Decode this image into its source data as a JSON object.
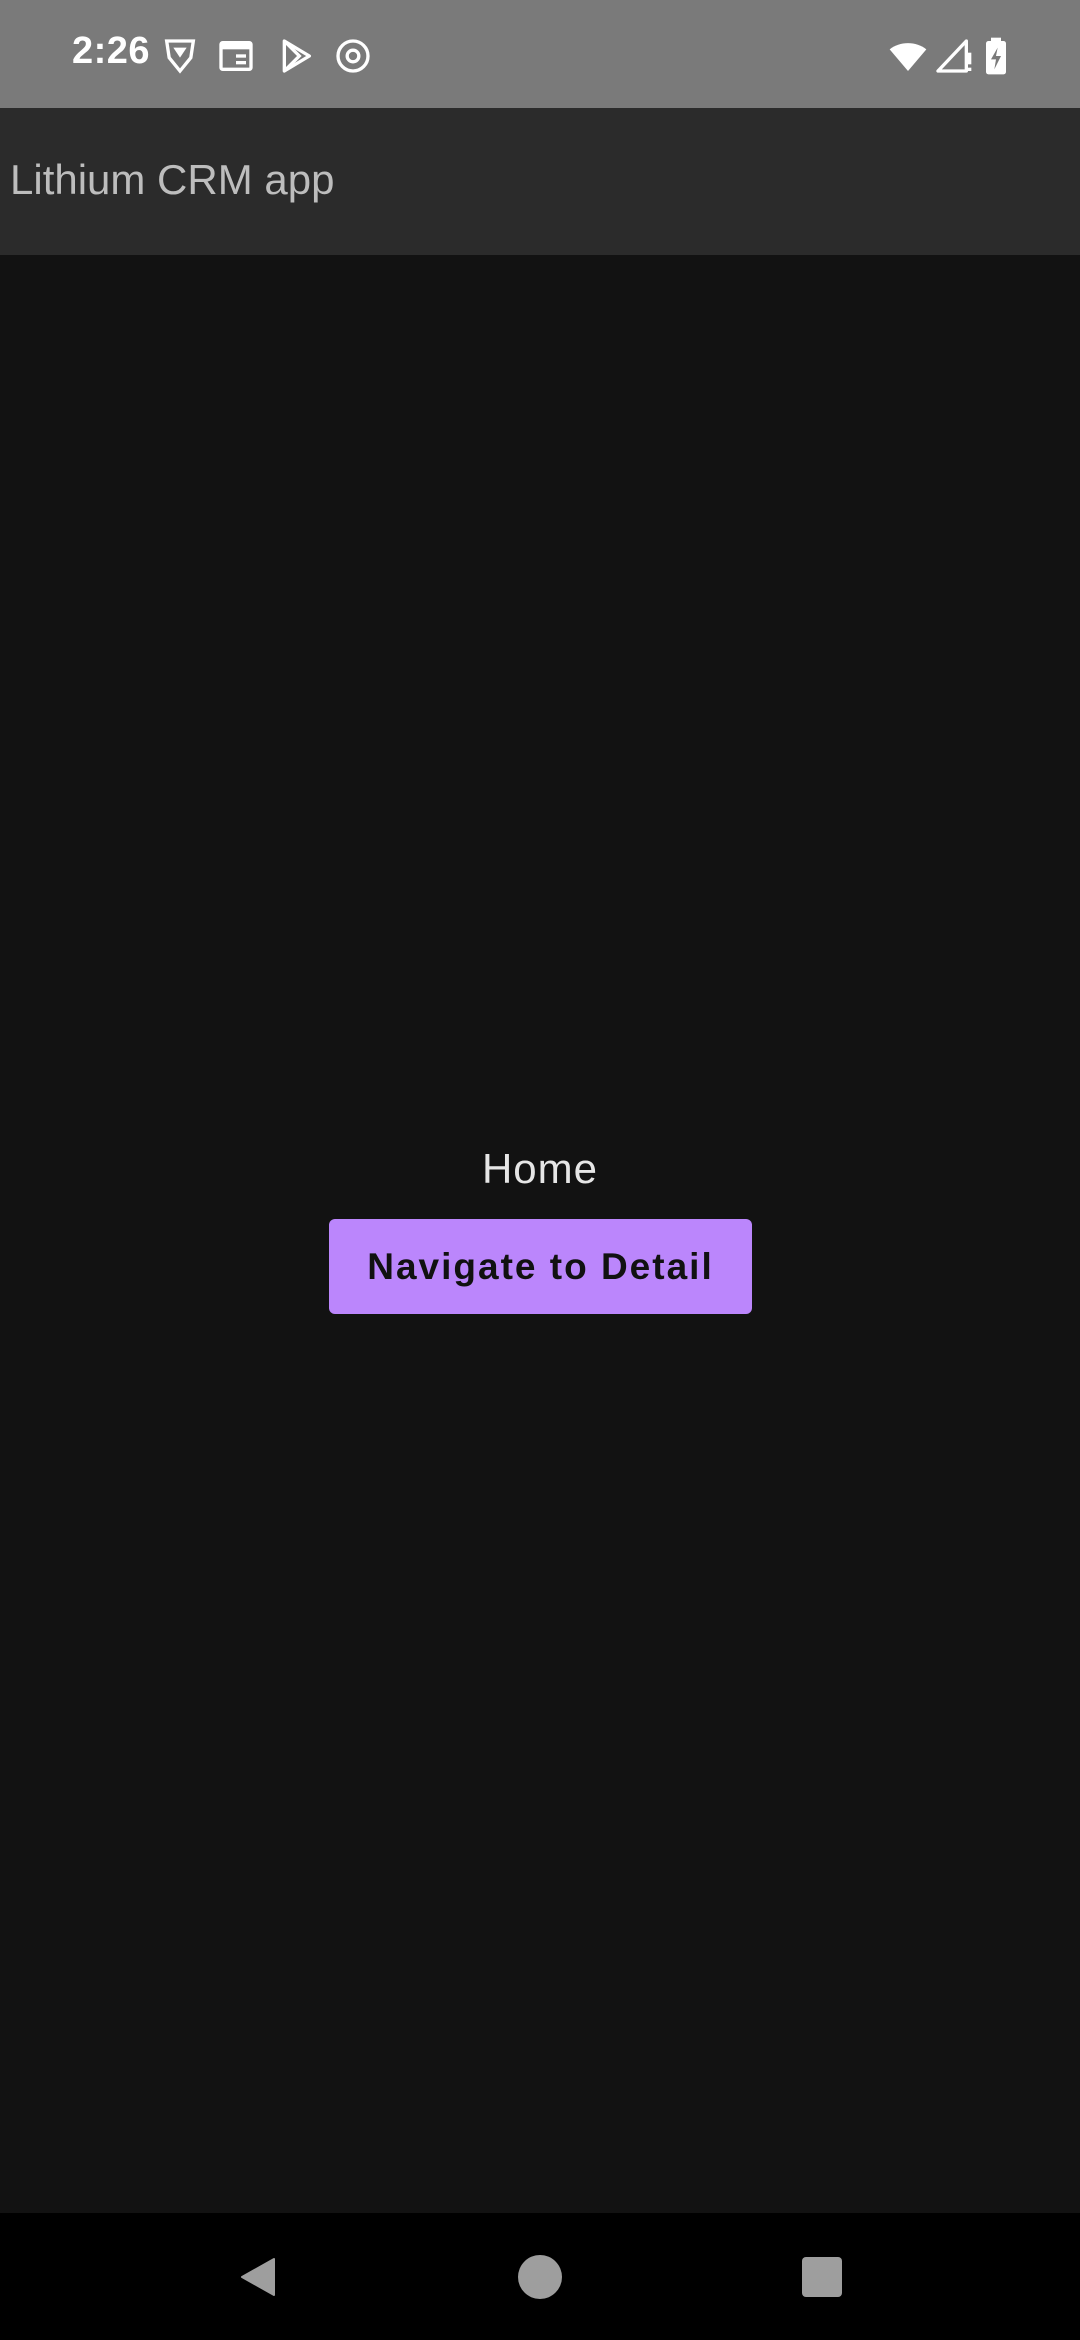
{
  "status_bar": {
    "time": "2:26",
    "left_icons": [
      "vpn-shield-icon",
      "calendar-icon",
      "play-store-icon",
      "threads-icon"
    ],
    "right_icons": [
      "wifi-icon",
      "cellular-signal-icon",
      "battery-charging-icon"
    ]
  },
  "app_bar": {
    "title": "Lithium CRM app"
  },
  "main": {
    "heading": "Home",
    "navigate_button_label": "Navigate to Detail"
  },
  "nav_bar": {
    "buttons": [
      "back-icon",
      "home-icon",
      "recents-icon"
    ]
  },
  "colors": {
    "status_bar_bg": "#7a7a7a",
    "app_bar_bg": "#2b2b2b",
    "content_bg": "#121212",
    "accent": "#bb86fc",
    "nav_bar_bg": "#000000"
  }
}
